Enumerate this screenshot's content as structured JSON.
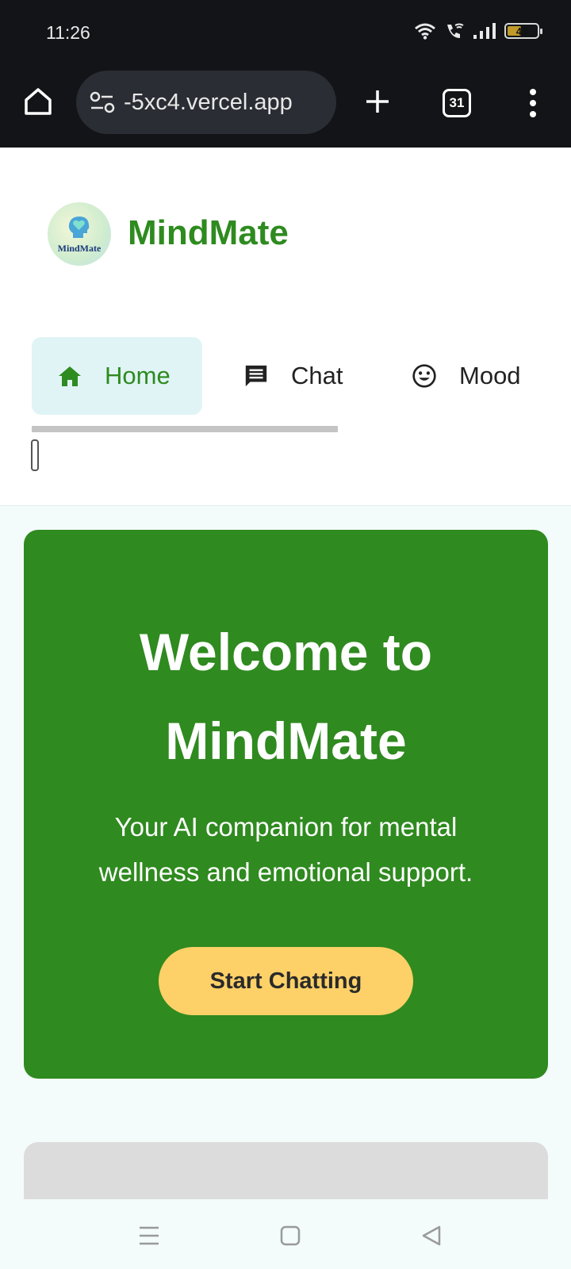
{
  "status_bar": {
    "time": "11:26",
    "battery": "43"
  },
  "browser": {
    "url_prefix": "",
    "url": "-5xc4.vercel.app",
    "tab_count": "31"
  },
  "app": {
    "brand": "MindMate",
    "logo_text": "MindMate",
    "nav": [
      {
        "label": "Home",
        "icon": "home-icon"
      },
      {
        "label": "Chat",
        "icon": "chat-icon"
      },
      {
        "label": "Mood",
        "icon": "smiley-icon"
      }
    ]
  },
  "hero": {
    "title_line1": "Welcome to",
    "title_line2": "MindMate",
    "subtitle_line1": "Your AI companion for mental",
    "subtitle_line2": "wellness and emotional support.",
    "cta": "Start Chatting"
  },
  "colors": {
    "brand_green": "#2e8b1f",
    "cta_yellow": "#fdd168",
    "active_tab_bg": "#e0f4f6"
  }
}
